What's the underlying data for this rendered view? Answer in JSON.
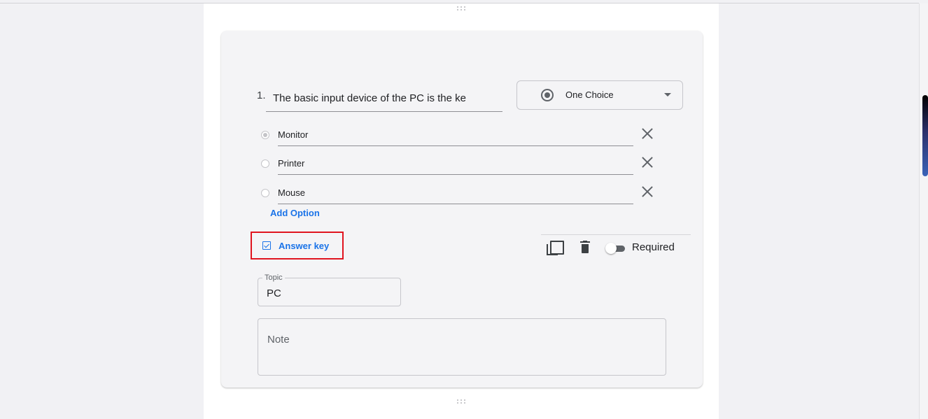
{
  "question": {
    "number": "1.",
    "title": "The basic input device of the PC is the ke",
    "type_select": {
      "value": "One Choice",
      "icon": "radio-button-icon"
    },
    "options": [
      {
        "label": "Monitor",
        "selected": true
      },
      {
        "label": "Printer",
        "selected": false
      },
      {
        "label": "Mouse",
        "selected": false
      }
    ],
    "add_option_label": "Add Option",
    "answer_key_label": "Answer key",
    "required_label": "Required",
    "required_on": false
  },
  "topic": {
    "legend": "Topic",
    "value": "PC"
  },
  "note": {
    "placeholder": "Note"
  },
  "colors": {
    "accent": "#1a73e8",
    "highlight_box": "#e0141f",
    "card_background": "#f4f4f6",
    "page_background": "#f1f1f4"
  }
}
